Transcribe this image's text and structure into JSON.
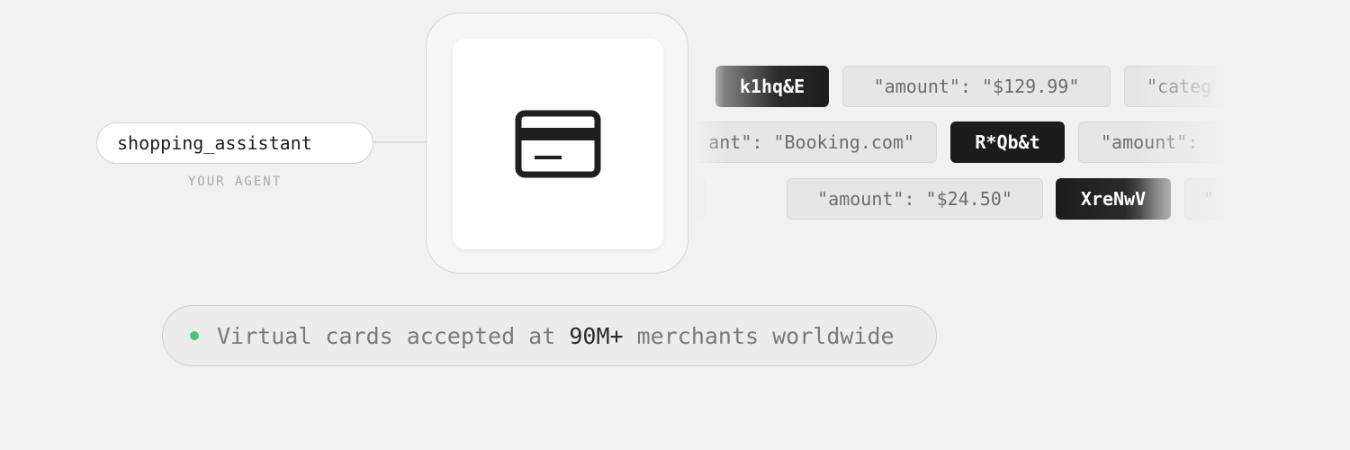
{
  "agent": {
    "name": "shopping_assistant",
    "caption": "YOUR AGENT"
  },
  "card": {
    "icon": "credit-card-icon",
    "colors": {
      "icon": "#1f1f1f"
    }
  },
  "stream": {
    "row1": [
      "k1hq&E",
      "\"amount\": \"$129.99\"",
      "\"categ"
    ],
    "row2": [
      "ant\": \"Booking.com\"",
      "R*Qb&t",
      "\"amount\":"
    ],
    "row3": [
      "\"amount\": \"$24.50\"",
      "XreNwV",
      "\""
    ]
  },
  "status": {
    "prefix": "Virtual cards accepted at ",
    "highlight": "90M+",
    "suffix": " merchants worldwide",
    "dot_color": "#4ac284"
  }
}
